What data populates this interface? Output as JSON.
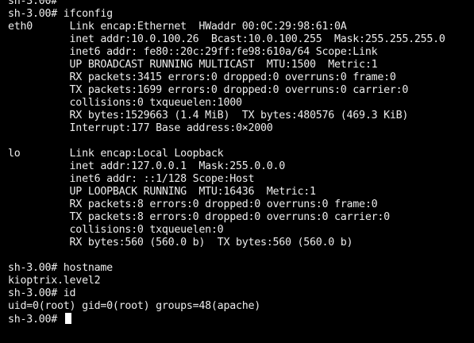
{
  "terminal": {
    "colors": {
      "background": "#000000",
      "foreground": "#ececec",
      "cursor": "#ffffff"
    },
    "lines": [
      "sh-3.00#",
      "sh-3.00# ifconfig",
      "eth0      Link encap:Ethernet  HWaddr 00:0C:29:98:61:0A",
      "          inet addr:10.0.100.26  Bcast:10.0.100.255  Mask:255.255.255.0",
      "          inet6 addr: fe80::20c:29ff:fe98:610a/64 Scope:Link",
      "          UP BROADCAST RUNNING MULTICAST  MTU:1500  Metric:1",
      "          RX packets:3415 errors:0 dropped:0 overruns:0 frame:0",
      "          TX packets:1699 errors:0 dropped:0 overruns:0 carrier:0",
      "          collisions:0 txqueuelen:1000",
      "          RX bytes:1529663 (1.4 MiB)  TX bytes:480576 (469.3 KiB)",
      "          Interrupt:177 Base address:0×2000",
      "",
      "lo        Link encap:Local Loopback",
      "          inet addr:127.0.0.1  Mask:255.0.0.0",
      "          inet6 addr: ::1/128 Scope:Host",
      "          UP LOOPBACK RUNNING  MTU:16436  Metric:1",
      "          RX packets:8 errors:0 dropped:0 overruns:0 frame:0",
      "          TX packets:8 errors:0 dropped:0 overruns:0 carrier:0",
      "          collisions:0 txqueuelen:0",
      "          RX bytes:560 (560.0 b)  TX bytes:560 (560.0 b)",
      "",
      "sh-3.00# hostname",
      "kioptrix.level2",
      "sh-3.00# id",
      "uid=0(root) gid=0(root) groups=48(apache)"
    ],
    "prompt": "sh-3.00#"
  }
}
